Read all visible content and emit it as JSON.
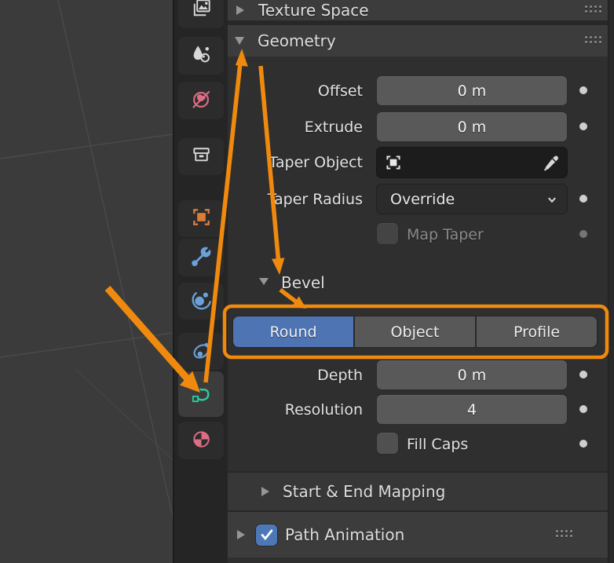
{
  "colors": {
    "annotation_orange": "#f08a0e",
    "selected_blue": "#4e74b3",
    "curve_icon_green": "#2dc79b",
    "world_material_pink": "#dd6d84",
    "modifier_icon_blue": "#6ba1d9",
    "object_icon_orange": "#dd7b38"
  },
  "tabbar": {
    "tabs": [
      {
        "icon": "view-layer"
      },
      {
        "icon": "scene"
      },
      {
        "icon": "world"
      },
      {
        "icon": "collection"
      },
      {
        "icon": "object"
      },
      {
        "icon": "modifiers"
      },
      {
        "icon": "physics"
      },
      {
        "icon": "constraints"
      },
      {
        "icon": "object-data-curve",
        "active": true
      },
      {
        "icon": "material"
      }
    ]
  },
  "panel": {
    "texture_space": {
      "title": "Texture Space",
      "expanded": false
    },
    "geometry": {
      "title": "Geometry",
      "expanded": true,
      "offset": {
        "label": "Offset",
        "value": "0 m"
      },
      "extrude": {
        "label": "Extrude",
        "value": "0 m"
      },
      "taper_object": {
        "label": "Taper Object",
        "value": ""
      },
      "taper_radius": {
        "label": "Taper Radius",
        "value": "Override"
      },
      "map_taper": {
        "label": "Map Taper",
        "checked": false,
        "enabled": false
      },
      "bevel": {
        "title": "Bevel",
        "modes": [
          "Round",
          "Object",
          "Profile"
        ],
        "active_mode": "Round",
        "depth": {
          "label": "Depth",
          "value": "0 m"
        },
        "resolution": {
          "label": "Resolution",
          "value": "4"
        },
        "fill_caps": {
          "label": "Fill Caps",
          "checked": false
        }
      }
    },
    "start_end_mapping": {
      "title": "Start & End Mapping",
      "expanded": false
    },
    "path_animation": {
      "title": "Path Animation",
      "expanded": false,
      "checked": true
    }
  }
}
